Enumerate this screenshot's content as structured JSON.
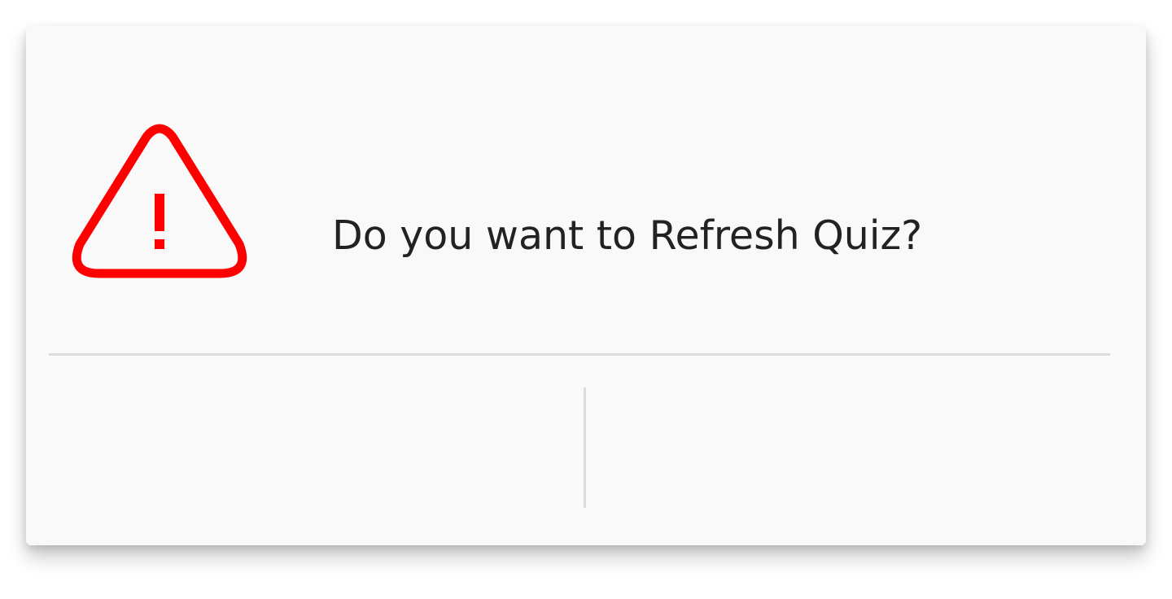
{
  "dialog": {
    "icon": "warning-triangle-icon",
    "accent_color": "#ff0000",
    "message": "Do you want to Refresh Quiz?",
    "buttons": {
      "left_label": "",
      "right_label": ""
    }
  }
}
